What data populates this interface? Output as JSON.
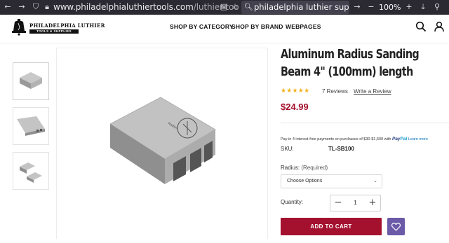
{
  "browser": {
    "url_host": "www.philadelphialuthiertools.com",
    "url_path": "/luthier-tools/",
    "search_text": "philadelphia luthier supply",
    "zoom": "100%",
    "icons": [
      "back-icon",
      "forward-icon",
      "reload-icon",
      "shield-icon",
      "lock-icon",
      "reader-icon",
      "search-icon",
      "next-icon",
      "menu-icon",
      "zoom-out-icon",
      "zoom-in-icon",
      "download-icon",
      "star-icon"
    ]
  },
  "header": {
    "logo_name": "PHILADELPHIA LUTHIER",
    "logo_sub": "TOOLS & SUPPLIES",
    "nav": [
      "SHOP BY CATEGORY",
      "SHOP BY BRAND",
      "WEBPAGES"
    ],
    "icons": [
      "search-icon",
      "account-icon"
    ]
  },
  "product": {
    "title": "Aluminum Radius Sanding Beam 4\" (100mm) length",
    "stars": "★★★★★",
    "reviews": "7 Reviews",
    "write_review": "Write a Review",
    "price": "$24.99",
    "paypal_text": "Pay in 4 interest-free payments on purchases of $30-$1,500 with",
    "paypal_brand_1": "Pay",
    "paypal_brand_2": "Pal",
    "paypal_learn": "Learn more",
    "sku_label": "SKU:",
    "sku_value": "TL-SB100",
    "radius_label": "Radius:",
    "radius_required": "(Required)",
    "select_value": "Choose Options",
    "qty_label": "Quantity:",
    "qty_value": "1",
    "add_to_cart": "ADD TO CART"
  },
  "colors": {
    "accent": "#a4112f",
    "wishlist": "#6b5aa8",
    "stars": "#f2b01e",
    "browser_bar": "#2b2a33"
  }
}
